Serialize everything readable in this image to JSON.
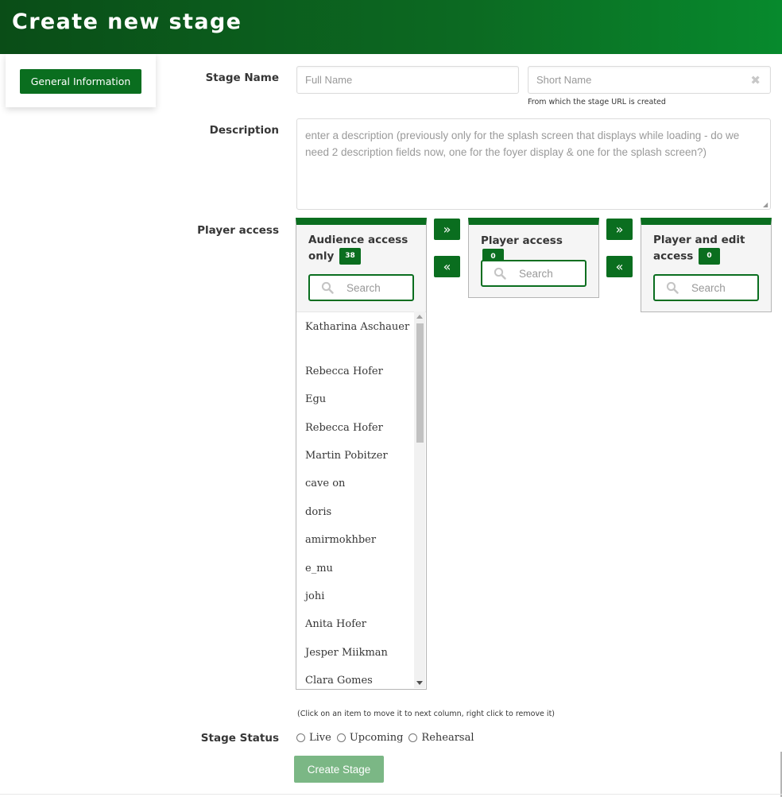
{
  "header": {
    "title": "Create new stage"
  },
  "sidebar": {
    "general_info_label": "General Information"
  },
  "form": {
    "stage_name": {
      "label": "Stage Name",
      "full_name_placeholder": "Full Name",
      "short_name_placeholder": "Short Name",
      "short_name_help": "From which the stage URL is created"
    },
    "description": {
      "label": "Description",
      "placeholder": "enter a description (previously only for the splash screen that displays while loading - do we need 2 description fields now, one for the foyer display & one for the splash screen?)"
    },
    "player_access": {
      "label": "Player access",
      "columns": [
        {
          "title_line1": "Audience access",
          "title_line2": "only",
          "count": "38",
          "search_placeholder": "Search"
        },
        {
          "title_line1": "Player access",
          "title_line2": "",
          "count": "0",
          "search_placeholder": "Search"
        },
        {
          "title_line1": "Player and edit",
          "title_line2": "access",
          "count": "0",
          "search_placeholder": "Search"
        }
      ],
      "move_right": "»",
      "move_left": "«",
      "audience_list": [
        "Katharina Aschauer",
        "Rebecca Hofer",
        "Egu",
        "Rebecca Hofer",
        "Martin Pobitzer",
        "cave on",
        "doris",
        "amirmokhber",
        "e_mu",
        "johi",
        "Anita Hofer",
        "Jesper Miikman",
        "Clara Gomes"
      ],
      "hint": "(Click on an item to move it to next column, right click to remove it)"
    },
    "stage_status": {
      "label": "Stage Status",
      "options": [
        "Live",
        "Upcoming",
        "Rehearsal"
      ]
    },
    "submit_label": "Create Stage"
  },
  "colors": {
    "brand_green": "#0a6e1f",
    "disabled_button": "#7bb785"
  }
}
